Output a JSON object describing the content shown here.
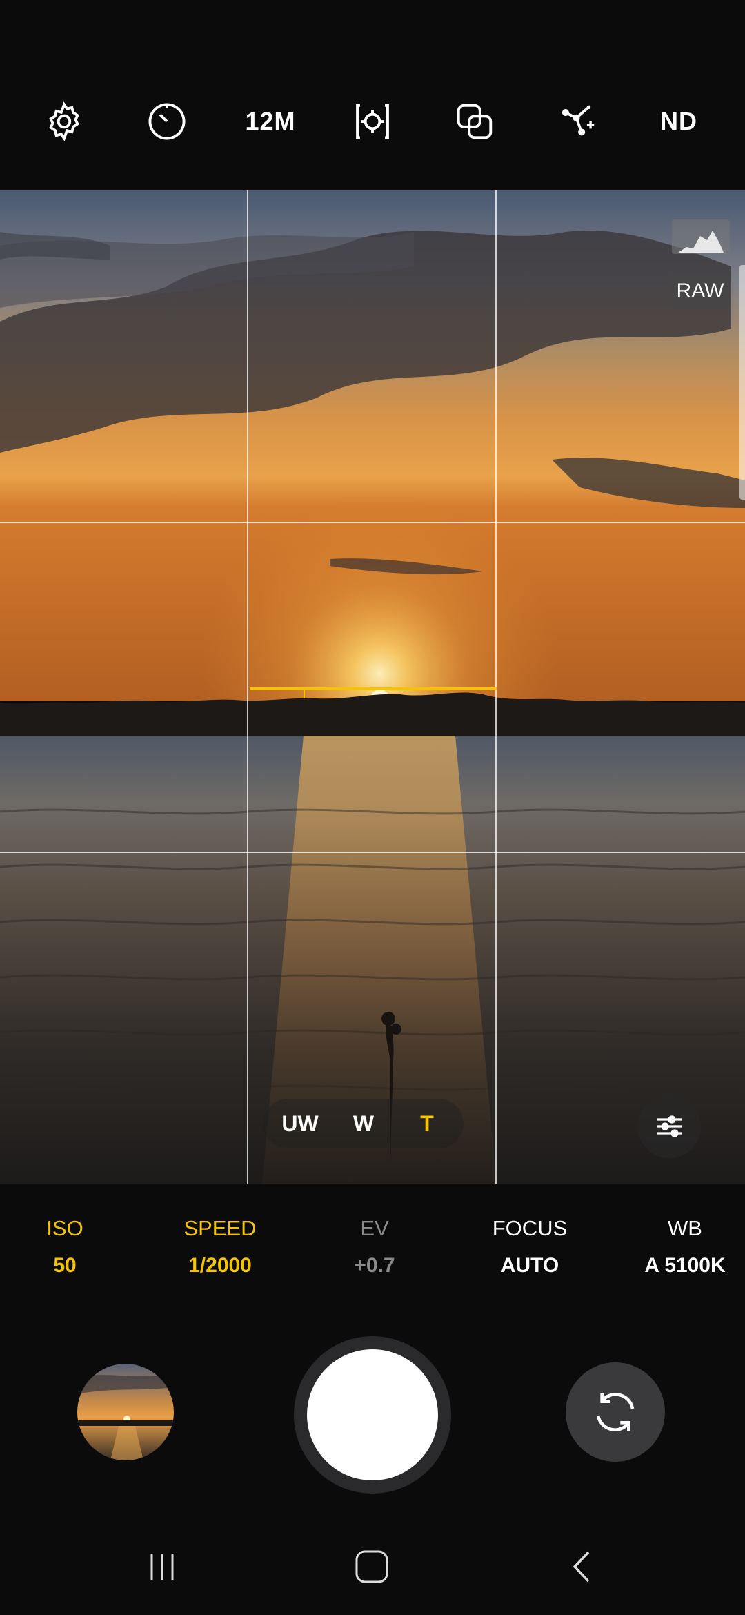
{
  "top_toolbar": {
    "items": [
      {
        "icon": "settings-gear-icon"
      },
      {
        "icon": "timer-icon"
      },
      {
        "label": "12M",
        "meaning": "resolution"
      },
      {
        "icon": "focus-target-icon"
      },
      {
        "icon": "overlapping-squares-icon"
      },
      {
        "icon": "sparkle-effects-icon"
      },
      {
        "label": "ND",
        "meaning": "nd-filter"
      }
    ]
  },
  "viewfinder": {
    "grid": "3x3",
    "histogram_icon": "histogram-icon",
    "raw_label": "RAW",
    "level_indicator_color": "#f4c400",
    "zoom": {
      "options": [
        "UW",
        "W",
        "T"
      ],
      "active": "T"
    },
    "adjust_icon": "sliders-icon"
  },
  "pro_settings": [
    {
      "label": "ISO",
      "value": "50",
      "state": "active"
    },
    {
      "label": "SPEED",
      "value": "1/2000",
      "state": "active"
    },
    {
      "label": "EV",
      "value": "+0.7",
      "state": "dim"
    },
    {
      "label": "FOCUS",
      "value": "AUTO",
      "state": "normal"
    },
    {
      "label": "WB",
      "value": "A 5100K",
      "state": "normal"
    }
  ],
  "bottom_controls": {
    "gallery_icon": "gallery-thumbnail",
    "shutter_icon": "shutter-button",
    "switch_icon": "switch-camera-icon"
  },
  "nav_bar": {
    "recents_icon": "recents-icon",
    "home_icon": "home-icon",
    "back_icon": "back-icon"
  },
  "colors": {
    "accent": "#f4c400",
    "background": "#0b0b0c",
    "dim_text": "#8a8a8a"
  }
}
